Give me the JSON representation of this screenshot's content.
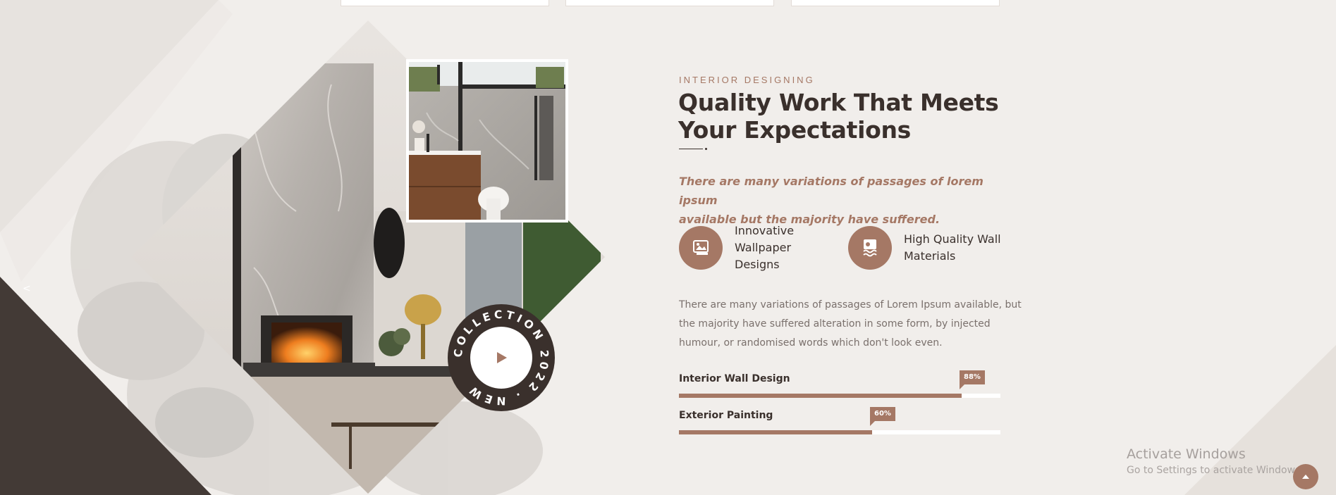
{
  "section": {
    "eyebrow": "INTERIOR DESIGNING",
    "title_line1": "Quality Work That Meets",
    "title_line2": "Your Expectations",
    "lead_line1": "There are many variations of passages of lorem ipsum",
    "lead_line2": "available but the majority have suffered.",
    "features": [
      {
        "icon": "wallpaper-image-icon",
        "line1": "Innovative",
        "line2": "Wallpaper Designs"
      },
      {
        "icon": "wall-roll-icon",
        "line1": "High Quality Wall",
        "line2": "Materials"
      }
    ],
    "body_line1": "There are many variations of passages of Lorem Ipsum available, but",
    "body_line2": "the majority have suffered alteration in some form, by injected",
    "body_line3": "humour, or randomised words which don't look even.",
    "skills": [
      {
        "label": "Interior Wall Design",
        "percent_text": "88%",
        "value": 88
      },
      {
        "label": "Exterior Painting",
        "percent_text": "60%",
        "value": 60
      }
    ]
  },
  "badge": {
    "ring_text": "COLLECTION 2022 . NEW ",
    "icon": "play-icon"
  },
  "system": {
    "activate_title": "Activate Windows",
    "activate_sub": "Go to Settings to activate Windows."
  },
  "colors": {
    "accent": "#a57865",
    "dark": "#3a302c",
    "background": "#f1eeeb"
  }
}
